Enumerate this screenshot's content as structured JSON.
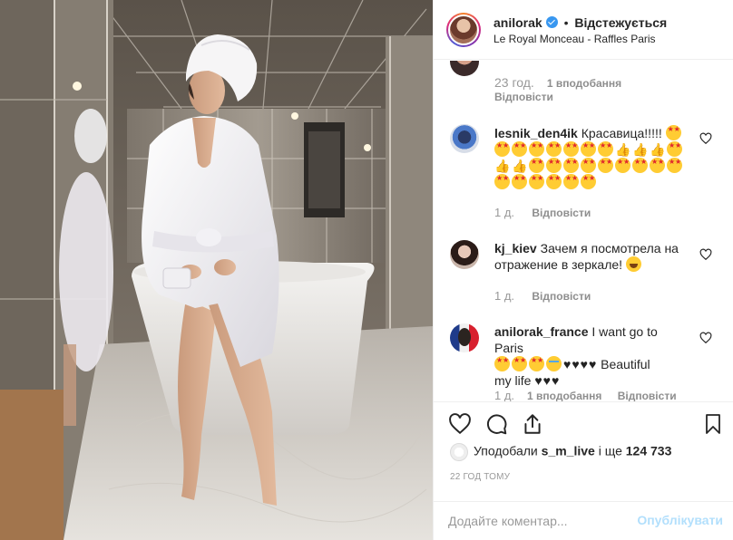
{
  "header": {
    "username": "anilorak",
    "separator": "•",
    "follow_label": "Відстежується",
    "location": "Le Royal Monceau - Raffles Paris"
  },
  "comments": [
    {
      "id": "partial",
      "user": "",
      "text": "",
      "time": "23 год.",
      "likes": "1 вподобання",
      "reply": "Відповісти"
    },
    {
      "id": "lesnik",
      "user": "lesnik_den4ik",
      "text": "Красавица!!!!!",
      "time": "1 д.",
      "likes": "",
      "reply": "Відповісти"
    },
    {
      "id": "kj",
      "user": "kj_kiev",
      "text": "Зачем я посмотрела на отражение в зеркале!",
      "time": "1 д.",
      "likes": "",
      "reply": "Відповісти"
    },
    {
      "id": "france",
      "user": "anilorak_france",
      "text": "I want go to Paris",
      "text2": "Beautiful",
      "text3": "my life",
      "time": "1 д.",
      "likes": "1 вподобання",
      "reply": "Відповісти"
    }
  ],
  "icons": {
    "like": "heart-icon",
    "comment": "comment-icon",
    "share": "share-icon",
    "save": "bookmark-icon"
  },
  "likes": {
    "prefix": "Уподобали",
    "user": "s_m_live",
    "middle": "і ще",
    "count": "124 733"
  },
  "time_ago": "22 год тому",
  "add_comment": {
    "placeholder": "Додайте коментар...",
    "post_label": "Опублікувати"
  },
  "colors": {
    "verified": "#3897f0",
    "post_disabled": "#b2dffc",
    "meta": "#999999"
  }
}
